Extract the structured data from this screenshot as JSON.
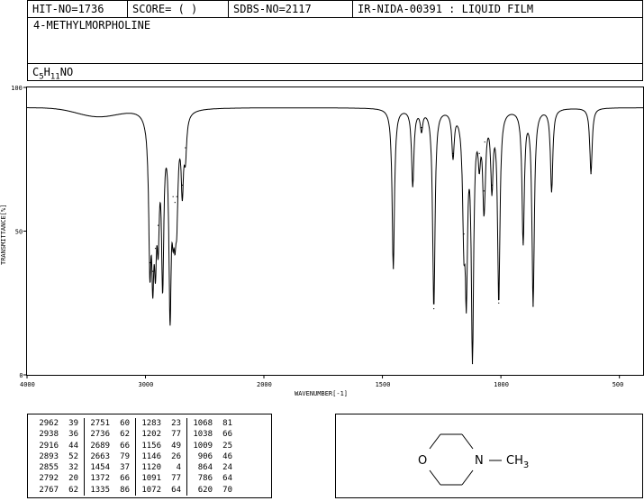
{
  "header": {
    "hit_no": "HIT-NO=1736",
    "score": "SCORE=  (   )",
    "sdbs_no": "SDBS-NO=2117",
    "ir_id": "IR-NIDA-00391 : LIQUID FILM",
    "compound_name": "4-METHYLMORPHOLINE",
    "formula": {
      "C": "C",
      "c_count": "5",
      "H": "H",
      "h_count": "11",
      "rest": "NO"
    }
  },
  "chart_data": {
    "type": "line",
    "xlabel": "WAVENUMBER[-1]",
    "ylabel": "TRANSMITTANCE[%]",
    "xlim": [
      4000,
      400
    ],
    "ylim": [
      0,
      100
    ],
    "x_ticks": [
      "4000",
      "3000",
      "2000",
      "1500",
      "1000",
      "500"
    ],
    "y_ticks": [
      "100",
      "50",
      "0"
    ],
    "baseline": 93,
    "peaks": [
      {
        "x": 2962,
        "y": 39
      },
      {
        "x": 2938,
        "y": 36
      },
      {
        "x": 2916,
        "y": 44
      },
      {
        "x": 2893,
        "y": 52
      },
      {
        "x": 2855,
        "y": 32
      },
      {
        "x": 2792,
        "y": 20
      },
      {
        "x": 2767,
        "y": 62
      },
      {
        "x": 2751,
        "y": 60
      },
      {
        "x": 2736,
        "y": 62
      },
      {
        "x": 2689,
        "y": 66
      },
      {
        "x": 2663,
        "y": 79
      },
      {
        "x": 1454,
        "y": 37
      },
      {
        "x": 1372,
        "y": 66
      },
      {
        "x": 1335,
        "y": 86
      },
      {
        "x": 1283,
        "y": 23
      },
      {
        "x": 1202,
        "y": 77
      },
      {
        "x": 1156,
        "y": 49
      },
      {
        "x": 1146,
        "y": 26
      },
      {
        "x": 1120,
        "y": 4
      },
      {
        "x": 1091,
        "y": 77
      },
      {
        "x": 1072,
        "y": 64
      },
      {
        "x": 1068,
        "y": 81
      },
      {
        "x": 1038,
        "y": 66
      },
      {
        "x": 1009,
        "y": 25
      },
      {
        "x": 906,
        "y": 46
      },
      {
        "x": 864,
        "y": 24
      },
      {
        "x": 786,
        "y": 64
      },
      {
        "x": 620,
        "y": 70
      }
    ]
  },
  "peak_table": [
    [
      "2962",
      "39",
      "2751",
      "60",
      "1283",
      "23",
      "1068",
      "81"
    ],
    [
      "2938",
      "36",
      "2736",
      "62",
      "1202",
      "77",
      "1038",
      "66"
    ],
    [
      "2916",
      "44",
      "2689",
      "66",
      "1156",
      "49",
      "1009",
      "25"
    ],
    [
      "2893",
      "52",
      "2663",
      "79",
      "1146",
      "26",
      "906",
      "46"
    ],
    [
      "2855",
      "32",
      "1454",
      "37",
      "1120",
      "4",
      "864",
      "24"
    ],
    [
      "2792",
      "20",
      "1372",
      "66",
      "1091",
      "77",
      "786",
      "64"
    ],
    [
      "2767",
      "62",
      "1335",
      "86",
      "1072",
      "64",
      "620",
      "70"
    ]
  ],
  "structure": {
    "o_label": "O",
    "n_label": "N",
    "ch3_label": "CH",
    "ch3_sub": "3"
  }
}
